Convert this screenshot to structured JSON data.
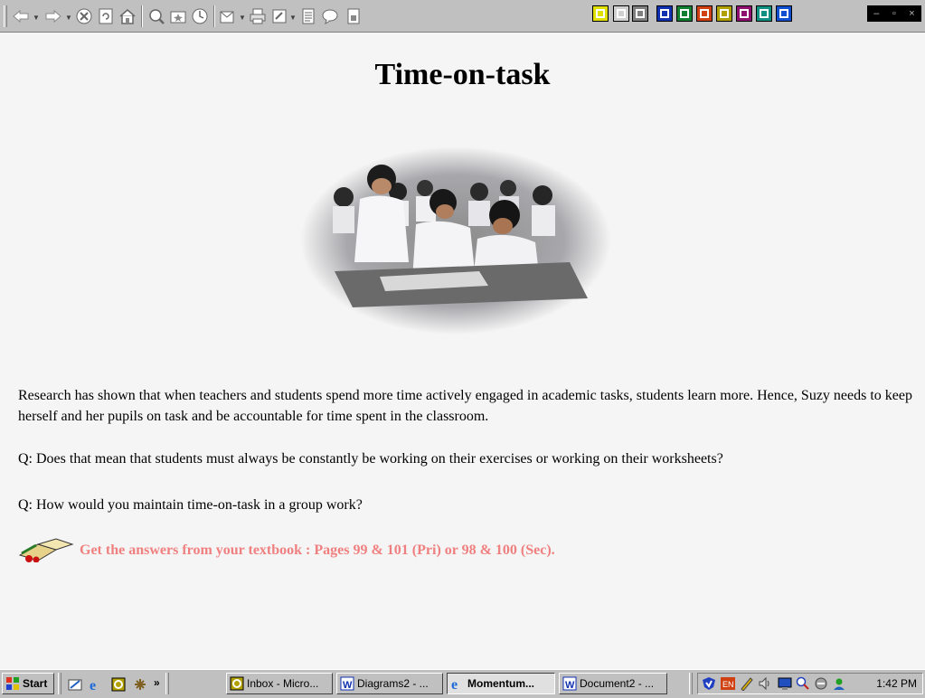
{
  "browser": {
    "toolbar": {
      "buttons": [
        "back-icon",
        "forward-icon",
        "stop-icon",
        "refresh-icon",
        "home-icon",
        "search-icon",
        "favorites-icon",
        "history-icon",
        "mail-icon",
        "print-icon",
        "edit-icon",
        "discuss-icon",
        "messenger-icon"
      ]
    },
    "window_controls": {
      "minimize": "–",
      "restore": "▫",
      "close": "×"
    }
  },
  "page": {
    "title": "Time-on-task",
    "photo_alt": "Students working together in a classroom",
    "paragraph": "Research has shown that when teachers and students spend more time actively engaged in academic tasks, students learn more. Hence, Suzy needs to keep herself and her pupils on task and be accountable for time spent in the classroom.",
    "question1": "Q: Does that mean that students must always be constantly be working on their exercises or working on their worksheets?",
    "question2": "Q: How would you maintain time-on-task in a group work?",
    "answers_link": "Get the answers from your textbook : Pages 99 & 101 (Pri) or 98 & 100 (Sec).",
    "link_color": "#f08080"
  },
  "taskbar": {
    "start_label": "Start",
    "overflow_label": "»",
    "tasks": [
      {
        "label": "Inbox - Micro...",
        "icon": "outlook-icon"
      },
      {
        "label": "Diagrams2 - ...",
        "icon": "word-icon"
      },
      {
        "label": "Momentum...",
        "icon": "ie-icon",
        "active": true
      },
      {
        "label": "Document2 - ...",
        "icon": "word-icon"
      }
    ],
    "clock": "1:42 PM"
  }
}
